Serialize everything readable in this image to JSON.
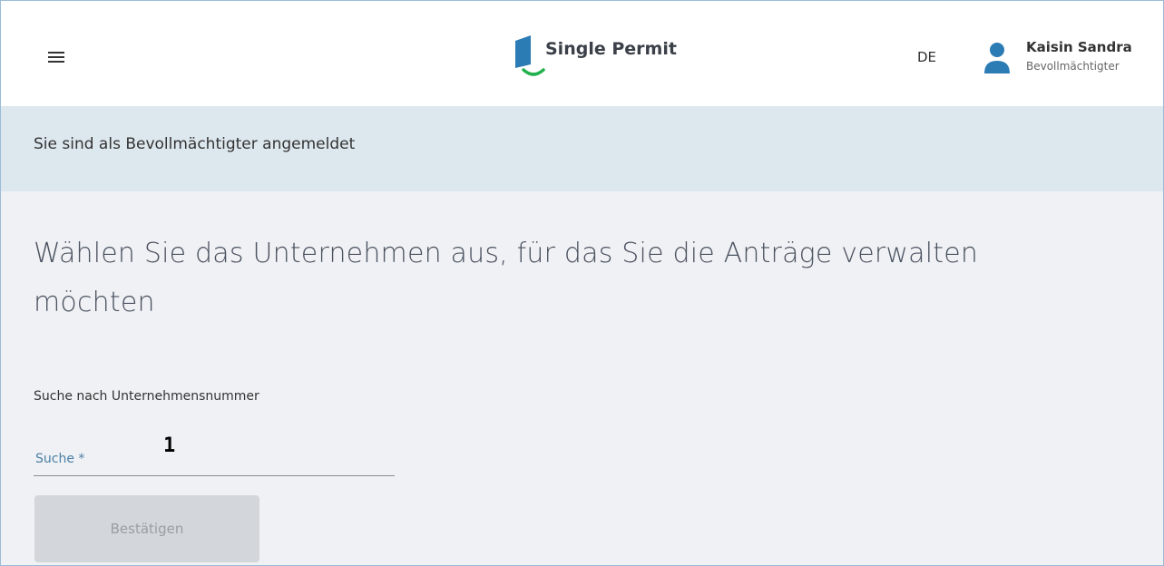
{
  "header": {
    "brand": "Single Permit",
    "language": "DE",
    "user_name": "Kaisin Sandra",
    "user_role": "Bevollmächtigter",
    "logo_colors": {
      "book": "#2b7bb5",
      "smile": "#22b14c"
    },
    "avatar_color": "#2b7bb5"
  },
  "banner": {
    "text": "Sie sind als Bevollmächtigter angemeldet"
  },
  "main": {
    "heading_line1": "Wählen Sie das Unternehmen aus, für das Sie die Anträge verwalten",
    "heading_line2": "möchten",
    "search_label": "Suche nach Unternehmensnummer",
    "annotation": "1",
    "search_placeholder": "Suche *",
    "search_value": "",
    "confirm_label": "Bestätigen"
  }
}
